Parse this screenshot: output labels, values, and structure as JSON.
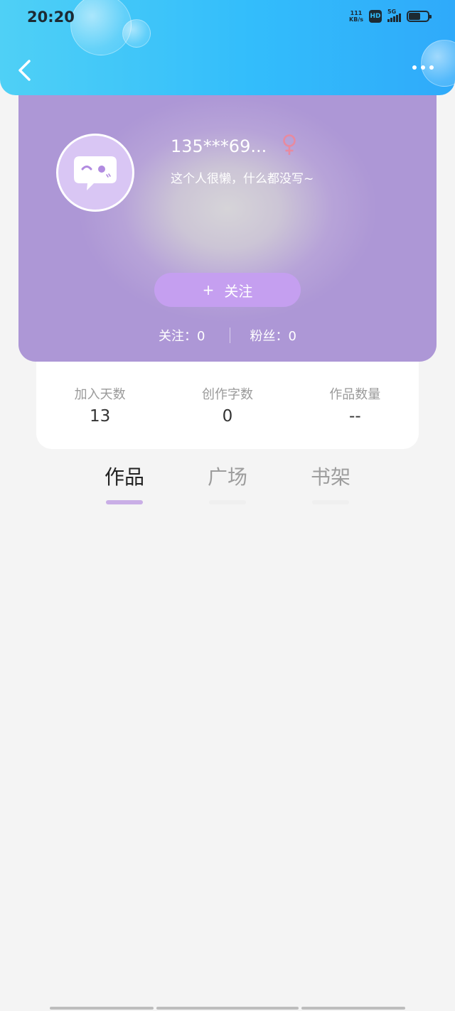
{
  "status_bar": {
    "time": "20:20",
    "net_speed_value": "111",
    "net_speed_unit": "KB/s",
    "hd_badge": "HD",
    "network": "5G"
  },
  "header": {
    "back_icon": "chevron-left-icon",
    "more_icon": "more-dots-icon",
    "gradient": [
      "#4fd0f6",
      "#2faafa"
    ]
  },
  "profile": {
    "username": "135***69...",
    "gender": "female",
    "gender_color": "#e88aa0",
    "bio": "这个人很懒，什么都没写~",
    "follow_button": {
      "icon": "+",
      "label": "关注"
    },
    "following": "关注：0",
    "followers": "粉丝：0",
    "accent": "#c59ff0"
  },
  "stats": [
    {
      "label": "加入天数",
      "value": "13"
    },
    {
      "label": "创作字数",
      "value": "0"
    },
    {
      "label": "作品数量",
      "value": "--"
    }
  ],
  "tabs": [
    {
      "label": "作品",
      "active": true
    },
    {
      "label": "广场",
      "active": false
    },
    {
      "label": "书架",
      "active": false
    }
  ]
}
